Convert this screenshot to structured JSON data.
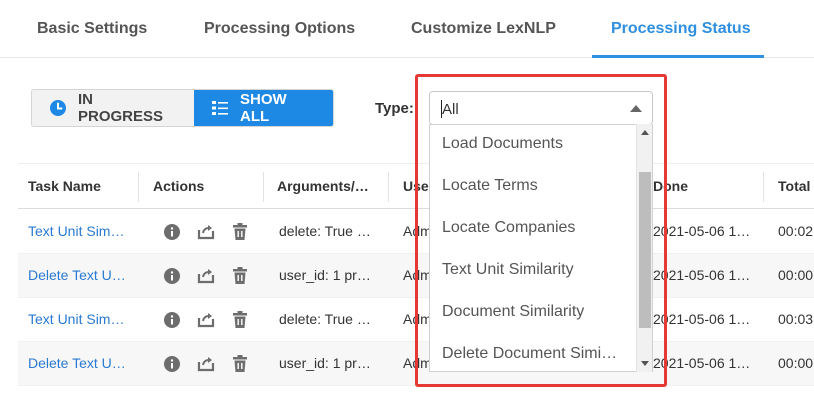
{
  "tabs": [
    {
      "label": "Basic Settings"
    },
    {
      "label": "Processing Options"
    },
    {
      "label": "Customize LexNLP"
    },
    {
      "label": "Processing Status",
      "active": true
    }
  ],
  "filters": {
    "in_progress_label": "IN PROGRESS",
    "show_all_label": "SHOW ALL",
    "in_progress_icon": "clock-icon",
    "show_all_icon": "list-icon"
  },
  "type_filter": {
    "label": "Type:",
    "selected": "All",
    "options": [
      "Load Documents",
      "Locate Terms",
      "Locate Companies",
      "Text Unit Similarity",
      "Document Similarity",
      "Delete Document Simi…"
    ]
  },
  "table": {
    "headers": [
      "Task Name",
      "Actions",
      "Arguments/…",
      "Use",
      "Done",
      "Total"
    ],
    "rows": [
      {
        "name": "Text Unit Sim…",
        "args": "delete: True …",
        "user": "Adm",
        "done": "2021-05-06 1…",
        "total": "00:02"
      },
      {
        "name": "Delete Text U…",
        "args": "user_id: 1 pr…",
        "user": "Adm",
        "done": "2021-05-06 1…",
        "total": "00:00"
      },
      {
        "name": "Text Unit Sim…",
        "args": "delete: True …",
        "user": "Adm",
        "done": "2021-05-06 1…",
        "total": "00:03"
      },
      {
        "name": "Delete Text U…",
        "args": "user_id: 1 pr…",
        "user": "Adm",
        "done": "2021-05-06 1…",
        "total": "00:00"
      }
    ],
    "action_icons": [
      "info-icon",
      "retry-icon",
      "delete-icon"
    ]
  },
  "colors": {
    "accent": "#1e88e5",
    "link": "#2a7ad3",
    "highlight": "#e53935"
  }
}
